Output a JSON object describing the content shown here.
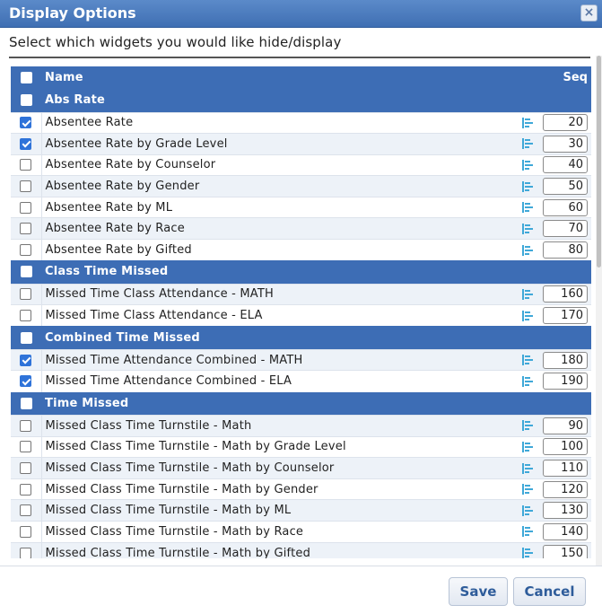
{
  "dialog": {
    "title": "Display Options",
    "close_label": "×",
    "instruction": "Select which widgets you would like hide/display"
  },
  "table": {
    "header": {
      "name": "Name",
      "seq": "Seq",
      "checked": false
    },
    "groups": [
      {
        "label": "Abs Rate",
        "checked": false,
        "items": [
          {
            "name": "Absentee Rate",
            "checked": true,
            "seq": "20"
          },
          {
            "name": "Absentee Rate by Grade Level",
            "checked": true,
            "seq": "30"
          },
          {
            "name": "Absentee Rate by Counselor",
            "checked": false,
            "seq": "40"
          },
          {
            "name": "Absentee Rate by Gender",
            "checked": false,
            "seq": "50"
          },
          {
            "name": "Absentee Rate by ML",
            "checked": false,
            "seq": "60"
          },
          {
            "name": "Absentee Rate by Race",
            "checked": false,
            "seq": "70"
          },
          {
            "name": "Absentee Rate by Gifted",
            "checked": false,
            "seq": "80"
          }
        ]
      },
      {
        "label": "Class Time Missed",
        "checked": false,
        "items": [
          {
            "name": "Missed Time Class Attendance - MATH",
            "checked": false,
            "seq": "160"
          },
          {
            "name": "Missed Time Class Attendance - ELA",
            "checked": false,
            "seq": "170"
          }
        ]
      },
      {
        "label": "Combined Time Missed",
        "checked": false,
        "items": [
          {
            "name": "Missed Time Attendance Combined - MATH",
            "checked": true,
            "seq": "180"
          },
          {
            "name": "Missed Time Attendance Combined - ELA",
            "checked": true,
            "seq": "190"
          }
        ]
      },
      {
        "label": "Time Missed",
        "checked": false,
        "items": [
          {
            "name": "Missed Class Time Turnstile - Math",
            "checked": false,
            "seq": "90"
          },
          {
            "name": "Missed Class Time Turnstile - Math by Grade Level",
            "checked": false,
            "seq": "100"
          },
          {
            "name": "Missed Class Time Turnstile - Math by Counselor",
            "checked": false,
            "seq": "110"
          },
          {
            "name": "Missed Class Time Turnstile - Math by Gender",
            "checked": false,
            "seq": "120"
          },
          {
            "name": "Missed Class Time Turnstile - Math by ML",
            "checked": false,
            "seq": "130"
          },
          {
            "name": "Missed Class Time Turnstile - Math by Race",
            "checked": false,
            "seq": "140"
          },
          {
            "name": "Missed Class Time Turnstile - Math by Gifted",
            "checked": false,
            "seq": "150"
          }
        ]
      }
    ]
  },
  "icons": {
    "row_icon": "bar-chart-icon",
    "icon_color": "#3fa8d8"
  },
  "colors": {
    "header_bg": "#3d6db5",
    "title_bg": "#4a7cc0",
    "accent_checkbox": "#2f73d9"
  },
  "footer": {
    "save_label": "Save",
    "cancel_label": "Cancel"
  }
}
